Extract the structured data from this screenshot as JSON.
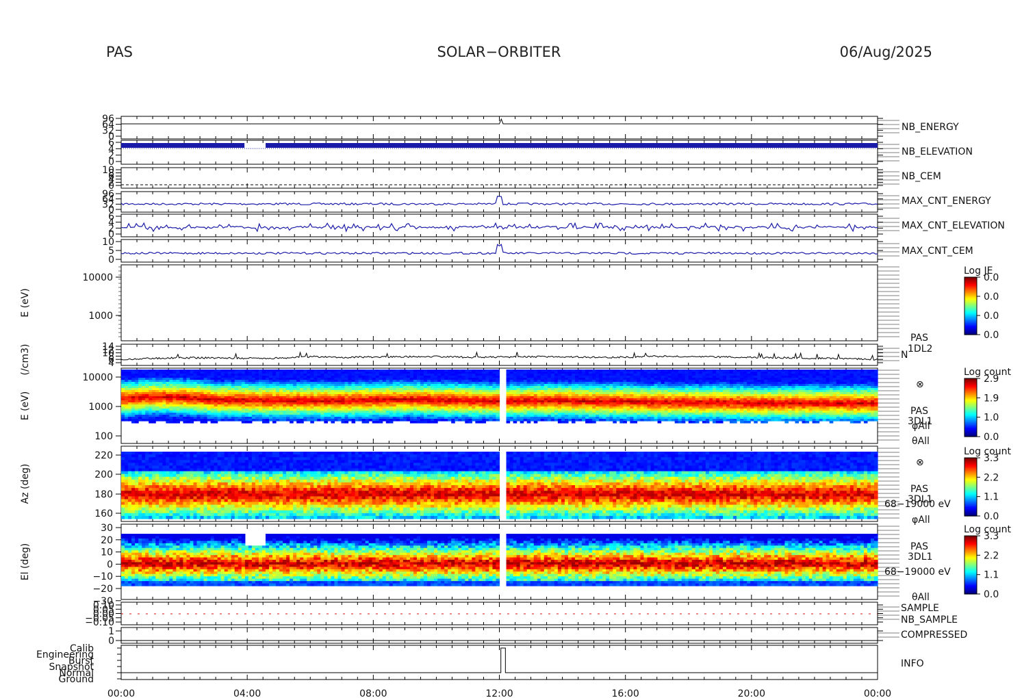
{
  "header": {
    "instrument": "PAS",
    "mission": "SOLAR−ORBITER",
    "date": "06/Aug/2025"
  },
  "colors": {
    "blue": "#1a1aa8",
    "red": "#dd1111",
    "black": "#000000"
  },
  "time_axis": {
    "labels": [
      "00:00",
      "04:00",
      "08:00",
      "12:00",
      "16:00",
      "20:00",
      "00:00"
    ]
  },
  "line_panels": [
    {
      "label": "NB_ENERGY",
      "label_color": "blue",
      "ticks": [
        "96",
        "64",
        "32",
        "0"
      ]
    },
    {
      "label": "NB_ELEVATION",
      "label_color": "blue",
      "ticks": [
        "6",
        "4",
        "2",
        "0"
      ]
    },
    {
      "label": "NB_CEM",
      "label_color": "blue",
      "ticks": [
        "10",
        "8",
        "6",
        "4",
        "2",
        "0"
      ]
    },
    {
      "label": "MAX_CNT_ENERGY",
      "label_color": "blue",
      "ticks": [
        "96",
        "64",
        "32",
        "0"
      ]
    },
    {
      "label": "MAX_CNT_ELEVATION",
      "label_color": "blue",
      "ticks": [
        "6",
        "4",
        "2",
        "0"
      ]
    },
    {
      "label": "MAX_CNT_CEM",
      "label_color": "blue",
      "ticks": [
        "10",
        "5",
        "0"
      ]
    }
  ],
  "empty_spectrogram": {
    "ylabel": "E (eV)",
    "ticks": [
      "10000",
      "1000"
    ],
    "colorbar": {
      "title": "Log JE",
      "ticks": [
        "0.0",
        "0.0",
        "0.0",
        "0.0"
      ]
    }
  },
  "density": {
    "ylabel": "(/cm3)",
    "ticks": [
      "14",
      "12",
      "10",
      "8",
      "6",
      "4"
    ],
    "right": [
      "PAS",
      "1DL2",
      "N"
    ]
  },
  "energy_spec": {
    "ylabel": "E (eV)",
    "ticks": [
      "10000",
      "1000",
      "100"
    ],
    "right": [
      "⊗",
      "PAS",
      "3DL1",
      "φAll",
      "θAll"
    ],
    "colorbar": {
      "title": "Log count",
      "ticks": [
        "2.9",
        "1.9",
        "1.0",
        "0.0"
      ]
    }
  },
  "az_spec": {
    "ylabel": "Az (deg)",
    "ticks": [
      "220",
      "200",
      "180",
      "160"
    ],
    "right": [
      "⊗",
      "PAS",
      "3DL1",
      "68−19000 eV",
      "φAll"
    ],
    "colorbar": {
      "title": "Log count",
      "ticks": [
        "3.3",
        "2.2",
        "1.1",
        "0.0"
      ]
    }
  },
  "el_spec": {
    "ylabel": "El (deg)",
    "ticks": [
      "30",
      "20",
      "10",
      "0",
      "−10",
      "−20",
      "−30"
    ],
    "right": [
      "PAS",
      "3DL1",
      "68−19000 eV",
      "θAll"
    ],
    "colorbar": {
      "title": "Log count",
      "ticks": [
        "3.3",
        "2.2",
        "1.1",
        "0.0"
      ]
    }
  },
  "sample_panel": {
    "ticks": [
      "0.10",
      "0.05",
      "0.00",
      "−0.05",
      "−0.10"
    ],
    "labels": [
      {
        "text": "SAMPLE",
        "color": "blue"
      },
      {
        "text": "NB_SAMPLE",
        "color": "red"
      }
    ]
  },
  "compressed_panel": {
    "ticks": [
      "1",
      "0"
    ],
    "label": "COMPRESSED"
  },
  "info_panel": {
    "categories": [
      "Calib",
      "Engineering",
      "Burst",
      "Snapshot",
      "Normal",
      "Ground"
    ],
    "label": "INFO"
  },
  "chart_data": {
    "type": "heatmap",
    "time_range": [
      "00:00",
      "00:00"
    ],
    "density_values": [
      5.6,
      6.5,
      6.8,
      6.7,
      6.4,
      6.6,
      7.4,
      7.0,
      7.2,
      7.3,
      7.5,
      7.0,
      7.2,
      7.3,
      7.4,
      7.0,
      7.1,
      7.6,
      7.3,
      7.2,
      7.0,
      6.8,
      6.5,
      6.4,
      5.8
    ],
    "energy_peak_ev": [
      2000,
      2300,
      2200,
      1800,
      1800,
      1700,
      1700,
      1700,
      1800,
      1900,
      1800,
      1700,
      1600,
      1700,
      1700,
      1600,
      1600,
      1500,
      1500,
      1500,
      1400,
      1400,
      1400,
      1400,
      1400
    ],
    "az_peak_deg": 180,
    "el_peak_deg": 0,
    "gap_time": "12:05"
  }
}
